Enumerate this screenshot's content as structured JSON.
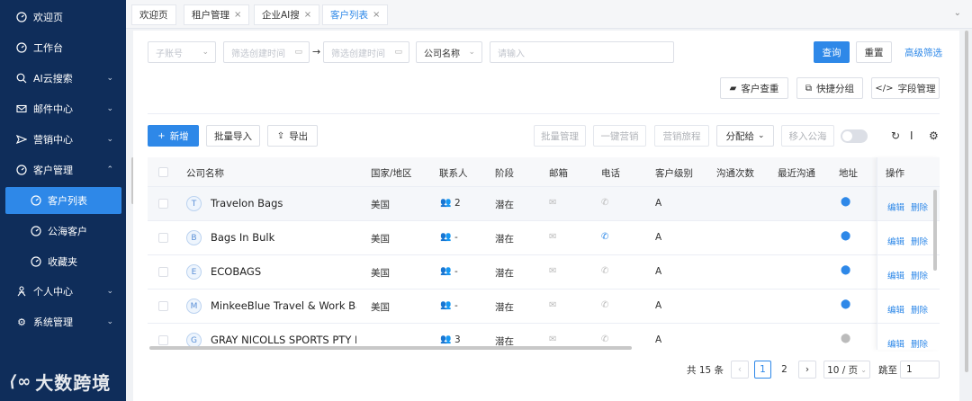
{
  "sidebar": {
    "items": [
      {
        "label": "欢迎页"
      },
      {
        "label": "工作台"
      },
      {
        "label": "AI云搜索"
      },
      {
        "label": "邮件中心"
      },
      {
        "label": "营销中心"
      },
      {
        "label": "客户管理"
      },
      {
        "label": "个人中心"
      },
      {
        "label": "系统管理"
      }
    ],
    "sub_items": [
      {
        "label": "客户列表"
      },
      {
        "label": "公海客户"
      },
      {
        "label": "收藏夹"
      }
    ],
    "logo_text": "大数跨境"
  },
  "tabs": [
    {
      "label": "欢迎页"
    },
    {
      "label": "租户管理"
    },
    {
      "label": "企业AI搜"
    },
    {
      "label": "客户列表"
    }
  ],
  "filters": {
    "sub_account_placeholder": "子账号",
    "start_date_placeholder": "筛选创建时间",
    "end_date_placeholder": "筛选创建时间",
    "company_select": "公司名称",
    "keyword_placeholder": "请输入",
    "query_label": "查询",
    "reset_label": "重置",
    "advanced_label": "高级筛选"
  },
  "actions": {
    "dedupe_label": "客户查重",
    "quick_group_label": "快捷分组",
    "field_manage_label": "字段管理",
    "new_label": "新增",
    "batch_import_label": "批量导入",
    "export_label": "导出",
    "batch_manage_label": "批量管理",
    "one_click_label": "一键营销",
    "journey_label": "营销旅程",
    "assign_label": "分配给",
    "move_pool_label": "移入公海"
  },
  "table": {
    "columns": [
      "公司名称",
      "国家/地区",
      "联系人",
      "阶段",
      "邮箱",
      "电话",
      "客户级别",
      "沟通次数",
      "最近沟通",
      "地址",
      "操作"
    ],
    "rows": [
      {
        "initial": "T",
        "company": "Travelon Bags",
        "country": "美国",
        "contacts": "2",
        "stage": "潜在",
        "phone_active": false,
        "level": "A",
        "address_active": true
      },
      {
        "initial": "B",
        "company": "Bags In Bulk",
        "country": "美国",
        "contacts": "-",
        "stage": "潜在",
        "phone_active": true,
        "level": "A",
        "address_active": true
      },
      {
        "initial": "E",
        "company": "ECOBAGS",
        "country": "美国",
        "contacts": "-",
        "stage": "潜在",
        "phone_active": false,
        "level": "A",
        "address_active": true
      },
      {
        "initial": "M",
        "company": "MinkeeBlue Travel & Work Bag",
        "country": "美国",
        "contacts": "-",
        "stage": "潜在",
        "phone_active": false,
        "level": "A",
        "address_active": true
      },
      {
        "initial": "G",
        "company": "GRAY NICOLLS SPORTS PTY LTD",
        "country": "",
        "contacts": "3",
        "stage": "潜在",
        "phone_active": false,
        "level": "A",
        "address_active": false
      }
    ],
    "edit_label": "编辑",
    "delete_label": "删除"
  },
  "pagination": {
    "total_text": "共 15 条",
    "pages": [
      "1",
      "2"
    ],
    "current_page": "1",
    "page_size": "10 / 页",
    "goto_label": "跳至",
    "goto_value": "1"
  },
  "colors": {
    "sidebar_bg": "#0f2d5a",
    "accent": "#2e88e8"
  }
}
